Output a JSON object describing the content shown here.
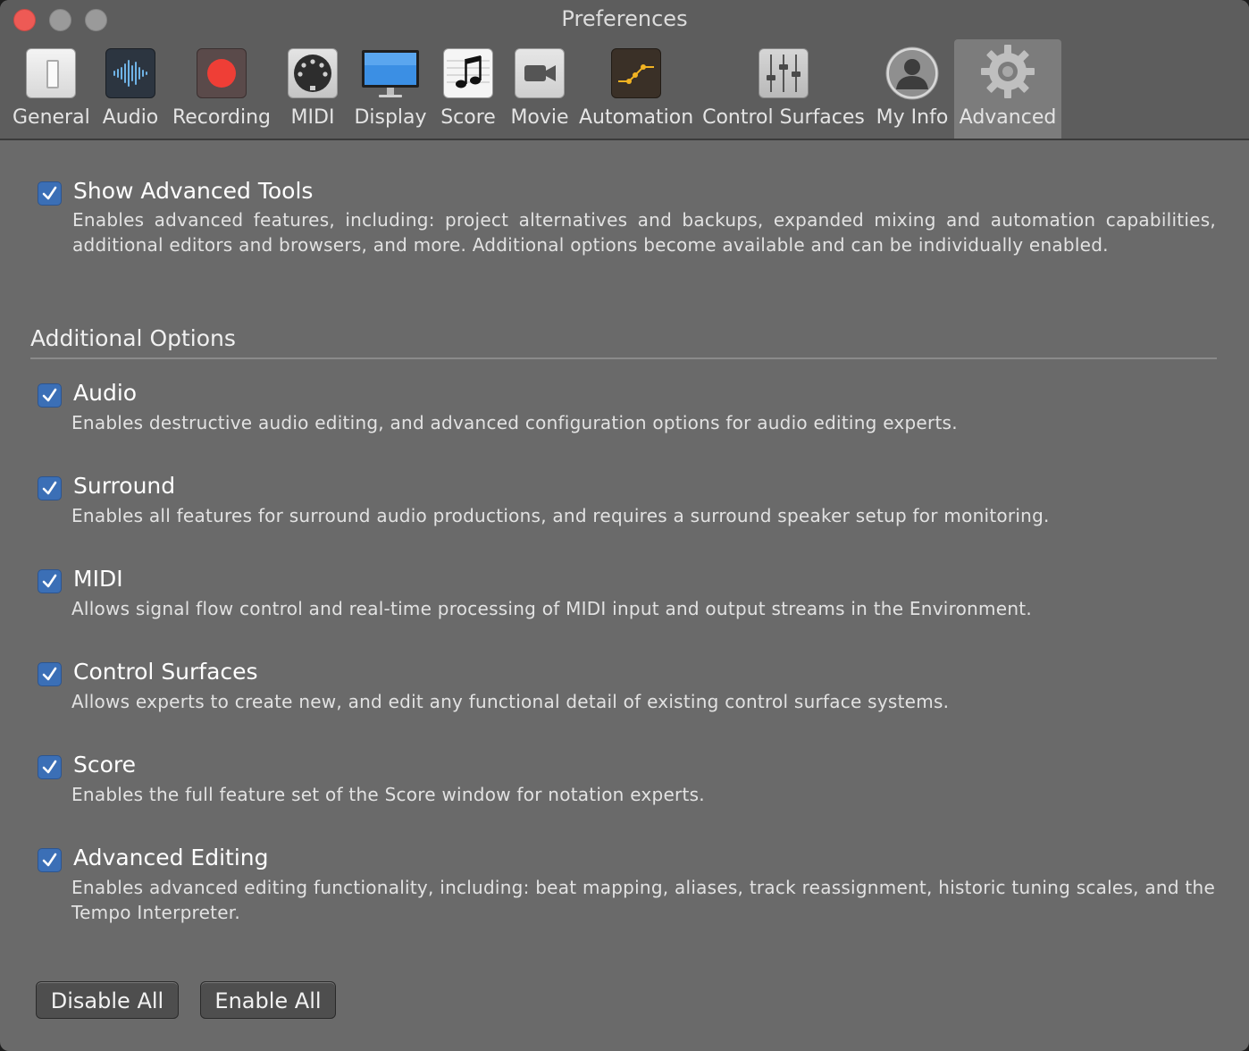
{
  "window": {
    "title": "Preferences"
  },
  "tabs": [
    {
      "label": "General",
      "icon": "general-icon"
    },
    {
      "label": "Audio",
      "icon": "audio-waveform-icon"
    },
    {
      "label": "Recording",
      "icon": "record-icon"
    },
    {
      "label": "MIDI",
      "icon": "midi-connector-icon"
    },
    {
      "label": "Display",
      "icon": "display-monitor-icon"
    },
    {
      "label": "Score",
      "icon": "music-note-icon"
    },
    {
      "label": "Movie",
      "icon": "video-camera-icon"
    },
    {
      "label": "Automation",
      "icon": "automation-curve-icon"
    },
    {
      "label": "Control Surfaces",
      "icon": "faders-icon"
    },
    {
      "label": "My Info",
      "icon": "user-silhouette-icon"
    },
    {
      "label": "Advanced",
      "icon": "gear-icon",
      "selected": true
    }
  ],
  "advanced_tools": {
    "label": "Show Advanced Tools",
    "checked": true,
    "description": "Enables advanced features, including: project alternatives and backups, expanded mixing and automation capabilities, additional editors and browsers, and more. Additional options become available and can be individually enabled."
  },
  "additional_options": {
    "title": "Additional Options",
    "items": [
      {
        "label": "Audio",
        "checked": true,
        "description": "Enables destructive audio editing, and advanced configuration options for audio editing experts."
      },
      {
        "label": "Surround",
        "checked": true,
        "description": "Enables all features for surround audio productions, and requires a surround speaker setup for monitoring."
      },
      {
        "label": "MIDI",
        "checked": true,
        "description": "Allows signal flow control and real-time processing of MIDI input and output streams in the Environment."
      },
      {
        "label": "Control Surfaces",
        "checked": true,
        "description": "Allows experts to create new, and edit any functional detail of existing control surface systems."
      },
      {
        "label": "Score",
        "checked": true,
        "description": "Enables the full feature set of the Score window for notation experts."
      },
      {
        "label": "Advanced Editing",
        "checked": true,
        "description": "Enables advanced editing functionality, including: beat mapping, aliases, track reassignment, historic tuning scales, and the Tempo Interpreter."
      }
    ]
  },
  "buttons": {
    "disable_all": "Disable All",
    "enable_all": "Enable All"
  },
  "colors": {
    "accent_checkbox": "#3b6fb6",
    "close_button": "#ee5a55",
    "record_red": "#ef3e36",
    "automation_yellow": "#f2b322"
  }
}
